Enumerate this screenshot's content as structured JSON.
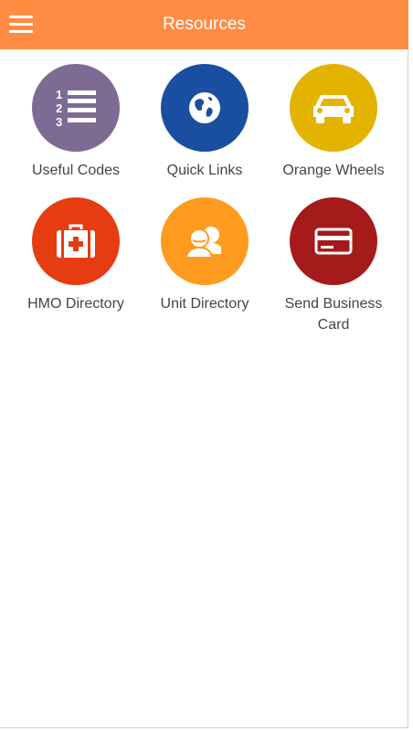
{
  "header": {
    "title": "Resources",
    "menu_icon": "hamburger-menu-icon",
    "color": "#ff8c42"
  },
  "tiles": [
    {
      "label": "Useful Codes",
      "icon": "numbered-list-icon",
      "color": "#7e6b93"
    },
    {
      "label": "Quick Links",
      "icon": "globe-icon",
      "color": "#1a4ea0"
    },
    {
      "label": "Orange Wheels",
      "icon": "car-icon",
      "color": "#e3b300"
    },
    {
      "label": "HMO Directory",
      "icon": "medical-kit-icon",
      "color": "#e53c12"
    },
    {
      "label": "Unit Directory",
      "icon": "people-icon",
      "color": "#ff9b1f"
    },
    {
      "label": "Send Business Card",
      "icon": "credit-card-icon",
      "color": "#a51a1a"
    }
  ]
}
